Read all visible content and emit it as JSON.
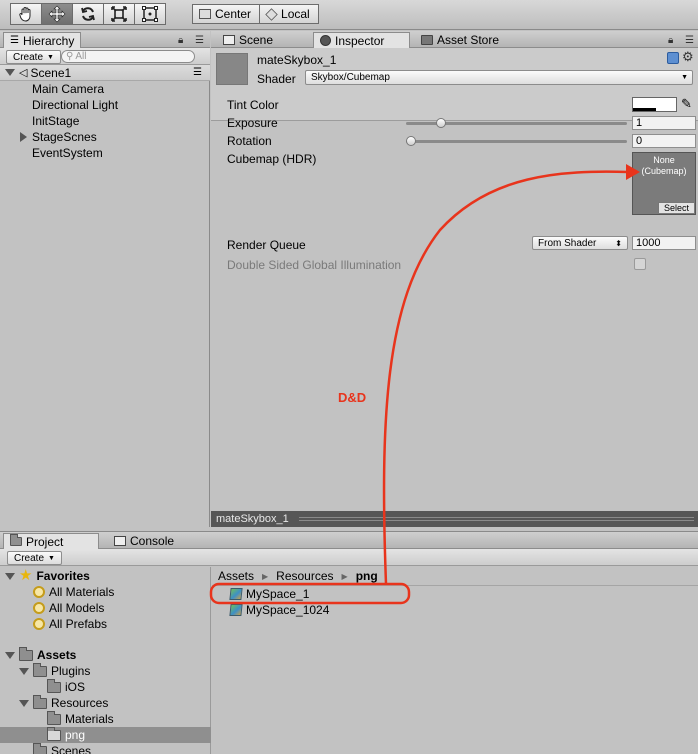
{
  "toolbar": {
    "tools": [
      {
        "name": "hand-tool-button",
        "icon": "hand-icon",
        "active": false
      },
      {
        "name": "move-tool-button",
        "icon": "move-arrows-icon",
        "active": true
      },
      {
        "name": "rotate-tool-button",
        "icon": "rotate-icon",
        "active": false
      },
      {
        "name": "scale-tool-button",
        "icon": "scale-icon",
        "active": false
      },
      {
        "name": "rect-tool-button",
        "icon": "rect-transform-icon",
        "active": false
      }
    ],
    "pivot_center": "Center",
    "pivot_local": "Local"
  },
  "hierarchy": {
    "tab_label": "Hierarchy",
    "create_label": "Create",
    "search_placeholder": "All",
    "scene_name": "Scene1",
    "items": [
      {
        "label": "Main Camera",
        "expandable": false
      },
      {
        "label": "Directional Light",
        "expandable": false
      },
      {
        "label": "InitStage",
        "expandable": false
      },
      {
        "label": "StageScnes",
        "expandable": true
      },
      {
        "label": "EventSystem",
        "expandable": false
      }
    ]
  },
  "inspector": {
    "tabs": [
      "Scene",
      "Inspector",
      "Asset Store"
    ],
    "material_name": "mateSkybox_1",
    "shader_label": "Shader",
    "shader_value": "Skybox/Cubemap",
    "props": {
      "tint_color": "Tint Color",
      "exposure": "Exposure",
      "exposure_value": "1",
      "exposure_level": 0.14,
      "rotation": "Rotation",
      "rotation_value": "0",
      "rotation_level": 0.0,
      "cubemap": "Cubemap   (HDR)",
      "cubemap_none": "None",
      "cubemap_type": "(Cubemap)",
      "cubemap_select": "Select",
      "render_queue": "Render Queue",
      "render_queue_mode": "From Shader",
      "render_queue_value": "1000",
      "double_sided_gi": "Double Sided Global Illumination"
    },
    "preview_label": "mateSkybox_1"
  },
  "project": {
    "tabs": [
      "Project",
      "Console"
    ],
    "create_label": "Create",
    "favorites_label": "Favorites",
    "favorites": [
      "All Materials",
      "All Models",
      "All Prefabs"
    ],
    "assets_label": "Assets",
    "folders": {
      "plugins": "Plugins",
      "ios": "iOS",
      "resources": "Resources",
      "materials": "Materials",
      "png": "png",
      "scenes": "Scenes"
    },
    "breadcrumb": [
      "Assets",
      "Resources",
      "png"
    ],
    "files": [
      "MySpace_1",
      "MySpace_1024"
    ]
  },
  "annotation": {
    "label": "D&D",
    "color": "#e8341c"
  }
}
